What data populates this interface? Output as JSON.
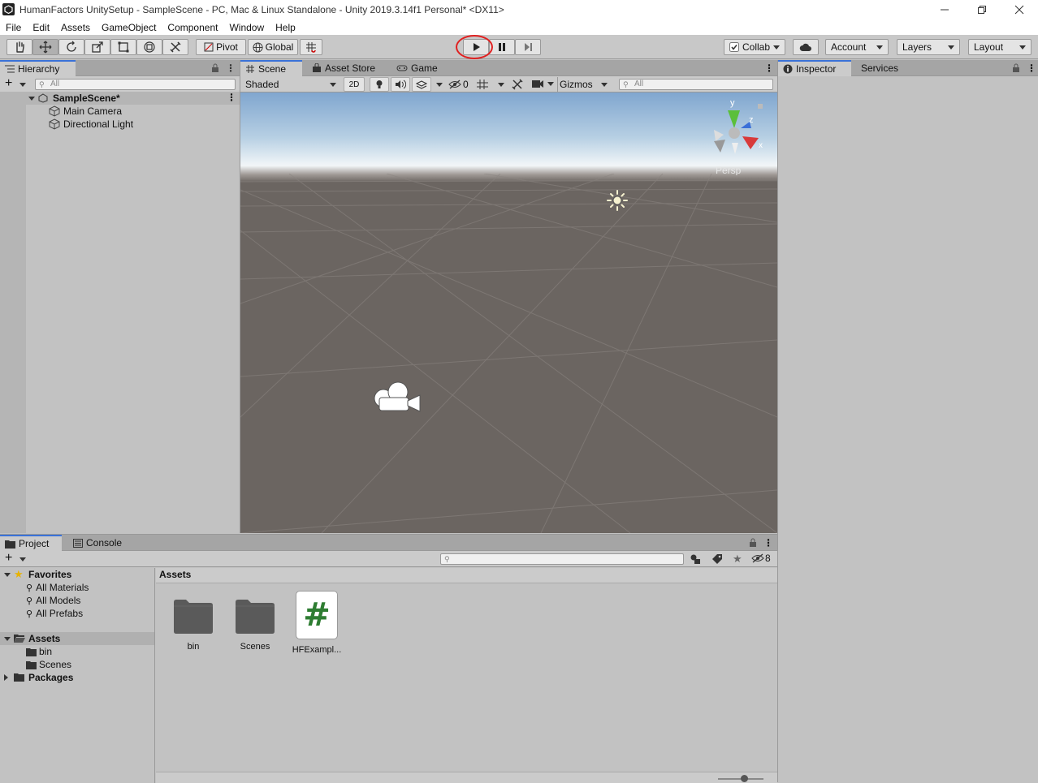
{
  "window": {
    "title": "HumanFactors UnitySetup - SampleScene - PC, Mac & Linux Standalone - Unity 2019.3.14f1 Personal* <DX11>"
  },
  "menu": [
    "File",
    "Edit",
    "Assets",
    "GameObject",
    "Component",
    "Window",
    "Help"
  ],
  "toolbar": {
    "pivot": "Pivot",
    "global": "Global",
    "collab": "Collab",
    "account": "Account",
    "layers": "Layers",
    "layout": "Layout"
  },
  "hierarchy": {
    "tab": "Hierarchy",
    "search_placeholder": "All",
    "scene": "SampleScene*",
    "items": [
      "Main Camera",
      "Directional Light"
    ]
  },
  "scene_tabs": {
    "scene": "Scene",
    "asset_store": "Asset Store",
    "game": "Game"
  },
  "scene_toolbar": {
    "shading": "Shaded",
    "mode2d": "2D",
    "hidden_count": "0",
    "gizmos": "Gizmos",
    "search_placeholder": "All",
    "persp": "Persp",
    "axis_y": "y",
    "axis_z": "z",
    "axis_x": "x"
  },
  "inspector": {
    "tab": "Inspector",
    "services": "Services"
  },
  "project": {
    "tab": "Project",
    "console": "Console",
    "hidden_count": "8",
    "breadcrumb": "Assets",
    "favorites": "Favorites",
    "favorite_items": [
      "All Materials",
      "All Models",
      "All Prefabs"
    ],
    "assets_root": "Assets",
    "asset_folders": [
      "bin",
      "Scenes"
    ],
    "packages": "Packages",
    "grid": [
      {
        "label": "bin",
        "kind": "folder"
      },
      {
        "label": "Scenes",
        "kind": "folder"
      },
      {
        "label": "HFExampl...",
        "kind": "script",
        "glyph": "#"
      }
    ]
  },
  "colors": {
    "accent": "#3a72d8",
    "annotation": "#e02020",
    "script_icon": "#2e7d32"
  }
}
